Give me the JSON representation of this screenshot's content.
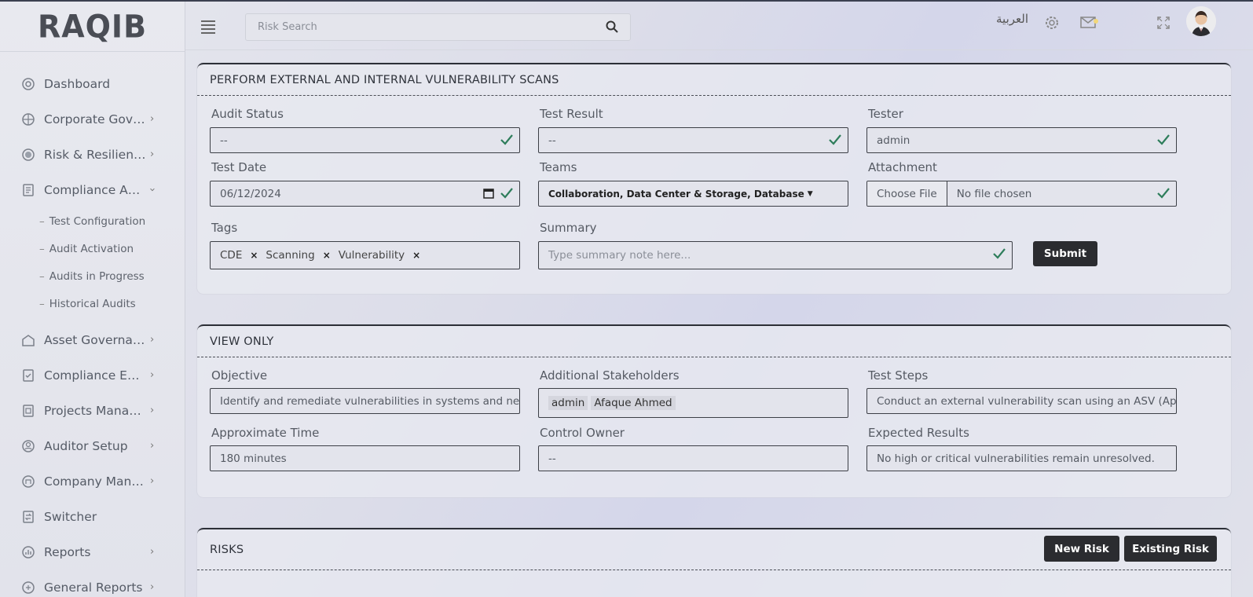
{
  "brand": {
    "logo_text": "RAQIB"
  },
  "header": {
    "search_placeholder": "Risk Search",
    "language_label": "العربية"
  },
  "sidebar": {
    "items": [
      {
        "label": "Dashboard",
        "chevron": false
      },
      {
        "label": "Corporate Governance",
        "chevron": true
      },
      {
        "label": "Risk & Resilience",
        "chevron": true
      },
      {
        "label": "Compliance Assessment",
        "chevron": true,
        "expanded": true
      }
    ],
    "sub_items": [
      "Test Configuration",
      "Audit Activation",
      "Audits in Progress",
      "Historical Audits"
    ],
    "items_after": [
      {
        "label": "Asset Governance",
        "chevron": true
      },
      {
        "label": "Compliance Evidence",
        "chevron": true
      },
      {
        "label": "Projects Management",
        "chevron": true
      },
      {
        "label": "Auditor Setup",
        "chevron": true
      },
      {
        "label": "Company Management",
        "chevron": true
      },
      {
        "label": "Switcher",
        "chevron": false
      },
      {
        "label": "Reports",
        "chevron": true
      },
      {
        "label": "General Reports",
        "chevron": true
      }
    ]
  },
  "perform_card": {
    "title": "PERFORM EXTERNAL AND INTERNAL VULNERABILITY SCANS",
    "audit_status": {
      "label": "Audit Status",
      "value": "--"
    },
    "test_result": {
      "label": "Test Result",
      "value": "--"
    },
    "tester": {
      "label": "Tester",
      "value": "admin"
    },
    "test_date": {
      "label": "Test Date",
      "value": "06/12/2024"
    },
    "teams": {
      "label": "Teams",
      "value": "Collaboration, Data Center & Storage, Database"
    },
    "attachment": {
      "label": "Attachment",
      "button": "Choose File",
      "status": "No file chosen"
    },
    "tags": {
      "label": "Tags",
      "values": [
        "CDE",
        "Scanning",
        "Vulnerability"
      ],
      "remove_glyph": "×"
    },
    "summary": {
      "label": "Summary",
      "placeholder": "Type summary note here..."
    },
    "submit_label": "Submit"
  },
  "view_card": {
    "title": "VIEW ONLY",
    "objective": {
      "label": "Objective",
      "value": "Identify and remediate vulnerabilities in systems and networks"
    },
    "stakeholders": {
      "label": "Additional Stakeholders",
      "values": [
        "admin",
        "Afaque Ahmed"
      ]
    },
    "test_steps": {
      "label": "Test Steps",
      "value": "Conduct an external vulnerability scan using an ASV (Approved Scanning Vendor)"
    },
    "approx_time": {
      "label": "Approximate Time",
      "value": "180 minutes"
    },
    "control_owner": {
      "label": "Control Owner",
      "value": "--"
    },
    "expected": {
      "label": "Expected Results",
      "value": "No high or critical vulnerabilities remain unresolved."
    }
  },
  "risks_card": {
    "title": "RISKS",
    "new_risk_label": "New Risk",
    "existing_risk_label": "Existing Risk"
  },
  "colors": {
    "accent_check": "#2e7d5b",
    "dark_button": "#2b2c30"
  }
}
